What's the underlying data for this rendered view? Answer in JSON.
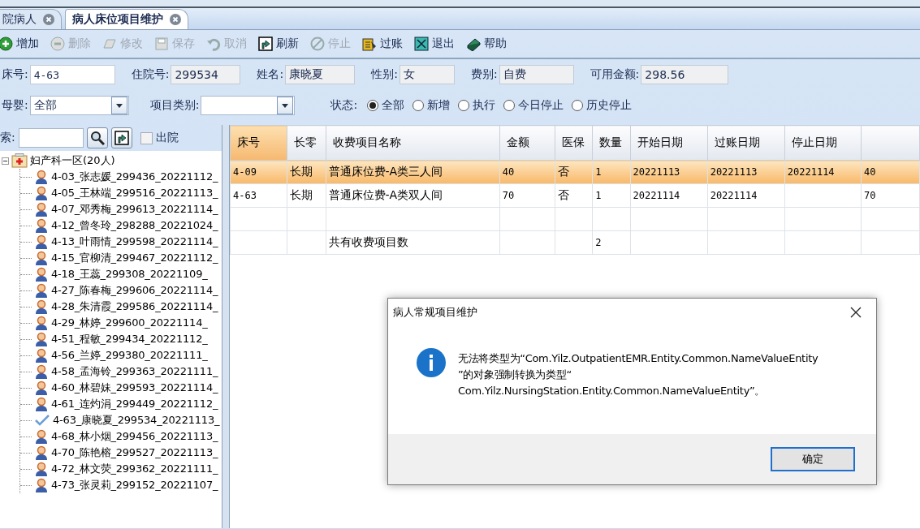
{
  "tabs": [
    {
      "label": "院病人",
      "selected": false
    },
    {
      "label": "病人床位项目维护",
      "selected": true
    }
  ],
  "toolbar": [
    {
      "kind": "add",
      "label": "增加",
      "disabled": false
    },
    {
      "kind": "delete",
      "label": "删除",
      "disabled": true
    },
    {
      "kind": "edit",
      "label": "修改",
      "disabled": true
    },
    {
      "kind": "save",
      "label": "保存",
      "disabled": true
    },
    {
      "kind": "cancel",
      "label": "取消",
      "disabled": true
    },
    {
      "kind": "refresh",
      "label": "刷新",
      "disabled": false
    },
    {
      "kind": "stop",
      "label": "停止",
      "disabled": true
    },
    {
      "kind": "post",
      "label": "过账",
      "disabled": false
    },
    {
      "kind": "exit",
      "label": "退出",
      "disabled": false
    },
    {
      "kind": "help",
      "label": "帮助",
      "disabled": false
    }
  ],
  "patient_fields": [
    {
      "label": "床号:",
      "value": "4-63",
      "readonly": false
    },
    {
      "label": "住院号:",
      "value": "299534",
      "readonly": true
    },
    {
      "label": "姓名:",
      "value": "康晓夏",
      "readonly": true
    },
    {
      "label": "性别:",
      "value": "女",
      "readonly": true
    },
    {
      "label": "费别:",
      "value": "自费",
      "readonly": true
    },
    {
      "label": "可用金额:",
      "value": "298.56",
      "readonly": true
    }
  ],
  "mother_baby": {
    "label": "母婴:",
    "value": "全部"
  },
  "item_category": {
    "label": "项目类别:"
  },
  "status": {
    "label": "状态:",
    "options": [
      {
        "label": "全部",
        "selected": true
      },
      {
        "label": "新增",
        "selected": false
      },
      {
        "label": "执行",
        "selected": false
      },
      {
        "label": "今日停止",
        "selected": false
      },
      {
        "label": "历史停止",
        "selected": false
      }
    ]
  },
  "search": {
    "label": "索:"
  },
  "discharged": {
    "label": "出院",
    "checked": false
  },
  "tree": {
    "label": "妇产科一区(20人)",
    "expanded": true,
    "children": [
      {
        "label": "4-03_张志媛_299436_20221112_",
        "checked": false
      },
      {
        "label": "4-05_王林端_299516_20221113_",
        "checked": false
      },
      {
        "label": "4-07_邓秀梅_299613_20221114_",
        "checked": false
      },
      {
        "label": "4-12_曾冬玲_298288_20221024_",
        "checked": false
      },
      {
        "label": "4-13_叶雨情_299598_20221114_",
        "checked": false
      },
      {
        "label": "4-15_官柳清_299467_20221112_",
        "checked": false
      },
      {
        "label": "4-18_王蕊_299308_20221109_",
        "checked": false
      },
      {
        "label": "4-27_陈春梅_299606_20221114_",
        "checked": false
      },
      {
        "label": "4-28_朱清霞_299586_20221114_",
        "checked": false
      },
      {
        "label": "4-29_林婷_299600_20221114_",
        "checked": false
      },
      {
        "label": "4-51_程敏_299434_20221112_",
        "checked": false
      },
      {
        "label": "4-56_兰婷_299380_20221111_",
        "checked": false
      },
      {
        "label": "4-58_孟海铃_299363_20221111_",
        "checked": false
      },
      {
        "label": "4-60_林碧妹_299593_20221114_",
        "checked": false
      },
      {
        "label": "4-61_连灼涓_299449_20221112_",
        "checked": false
      },
      {
        "label": "4-63_康晓夏_299534_20221113_",
        "checked": true
      },
      {
        "label": "4-68_林小烟_299456_20221113_",
        "checked": false
      },
      {
        "label": "4-70_陈艳榕_299527_20221113_",
        "checked": false
      },
      {
        "label": "4-72_林文荧_299362_20221111_",
        "checked": false
      },
      {
        "label": "4-73_张灵莉_299152_20221107_",
        "checked": false
      }
    ]
  },
  "table": {
    "columns": [
      "床号",
      "长零",
      "收费项目名称",
      "金额",
      "医保",
      "数量",
      "开始日期",
      "过账日期",
      "停止日期"
    ],
    "rows": [
      {
        "selected": true,
        "cells": [
          "4-09",
          "长期",
          "普通床位费-A类三人间",
          "40",
          "否",
          "1",
          "20221113",
          "20221113",
          "20221114",
          "40"
        ]
      },
      {
        "selected": false,
        "cells": [
          "4-63",
          "长期",
          "普通床位费-A类双人间",
          "70",
          "否",
          "1",
          "20221114",
          "20221114",
          "",
          "70"
        ]
      }
    ],
    "summary": {
      "label": "共有收费项目数",
      "count": "2"
    }
  },
  "dialog": {
    "title": "病人常规项目维护",
    "message": [
      "无法将类型为“Com.Yilz.OutpatientEMR.Entity.Common.NameValueEntity",
      "”的对象强制转换为类型“",
      "Com.Yilz.NursingStation.Entity.Common.NameValueEntity”。"
    ],
    "button": "确定"
  }
}
